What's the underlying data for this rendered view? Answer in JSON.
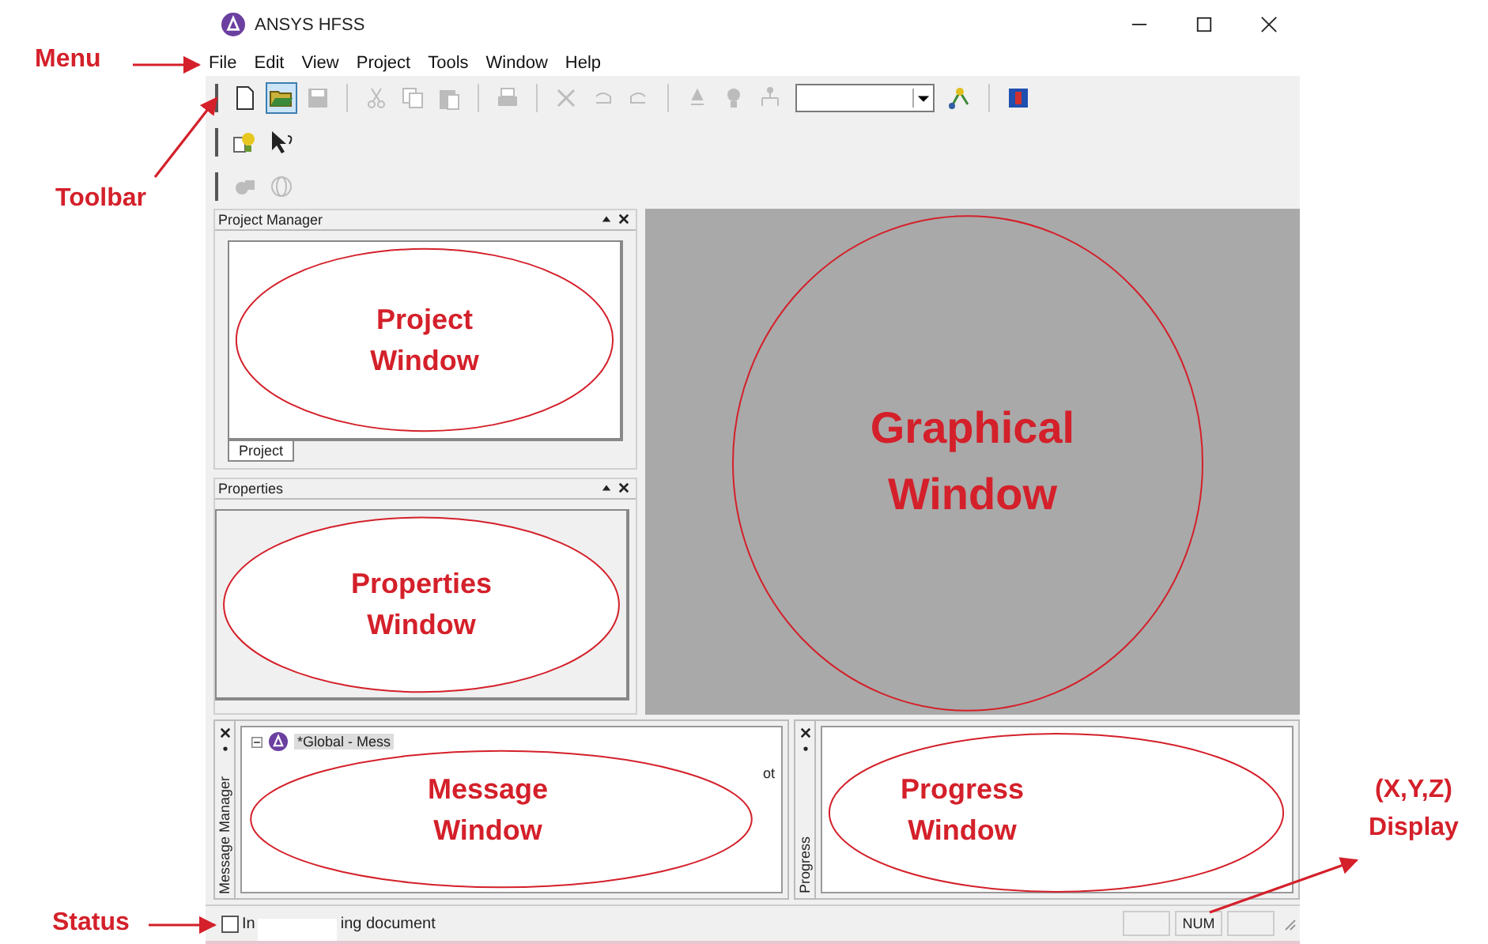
{
  "window": {
    "title": "ANSYS HFSS"
  },
  "menu": [
    "File",
    "Edit",
    "View",
    "Project",
    "Tools",
    "Window",
    "Help"
  ],
  "toolbars": [
    {
      "groups": [
        [
          {
            "kind": "new",
            "disabled": false,
            "pressed": false
          },
          {
            "kind": "open",
            "disabled": false,
            "pressed": true
          },
          {
            "kind": "save",
            "disabled": true,
            "pressed": false
          }
        ],
        [
          {
            "kind": "cut",
            "disabled": true,
            "pressed": false
          },
          {
            "kind": "copy",
            "disabled": true,
            "pressed": false
          },
          {
            "kind": "paste",
            "disabled": true,
            "pressed": false
          }
        ],
        [
          {
            "kind": "print",
            "disabled": true,
            "pressed": false
          }
        ],
        [
          {
            "kind": "delete",
            "disabled": true,
            "pressed": false
          },
          {
            "kind": "undo",
            "disabled": true,
            "pressed": false
          },
          {
            "kind": "redo",
            "disabled": true,
            "pressed": false
          }
        ],
        [
          {
            "kind": "up",
            "disabled": true,
            "pressed": false
          },
          {
            "kind": "bulb",
            "disabled": true,
            "pressed": false
          },
          {
            "kind": "tree",
            "disabled": true,
            "pressed": false
          },
          {
            "kind": "dropdown",
            "disabled": false,
            "pressed": false
          },
          {
            "kind": "graph",
            "disabled": false,
            "pressed": false
          }
        ],
        [
          {
            "kind": "book",
            "disabled": false,
            "pressed": false
          }
        ]
      ]
    },
    {
      "groups": [
        [
          {
            "kind": "helpbulb",
            "disabled": false,
            "pressed": false
          },
          {
            "kind": "pointer",
            "disabled": false,
            "pressed": false
          }
        ]
      ]
    },
    {
      "groups": [
        [
          {
            "kind": "shapes",
            "disabled": true,
            "pressed": false
          },
          {
            "kind": "sphere",
            "disabled": true,
            "pressed": false
          }
        ]
      ]
    }
  ],
  "project_manager": {
    "title": "Project Manager",
    "tabs": [
      {
        "label": "Project",
        "selected": true
      }
    ],
    "callout": "Project Window"
  },
  "properties": {
    "title": "Properties",
    "callout": "Properties Window"
  },
  "graphics": {
    "callout": "Graphical Window"
  },
  "message_manager": {
    "title": "Message Manager",
    "node": "*Global - Mess",
    "fragment": "ot",
    "callout": "Message Window"
  },
  "progress": {
    "title": "Progress",
    "callout": "Progress Window"
  },
  "status_bar": {
    "text_start": "In",
    "text_end": "ing document",
    "panes": [
      "NUM"
    ]
  },
  "callouts": [
    {
      "label": "Menu"
    },
    {
      "label": "Toolbar"
    },
    {
      "label": "Status"
    },
    {
      "label": "(X,Y,Z) Display"
    }
  ]
}
